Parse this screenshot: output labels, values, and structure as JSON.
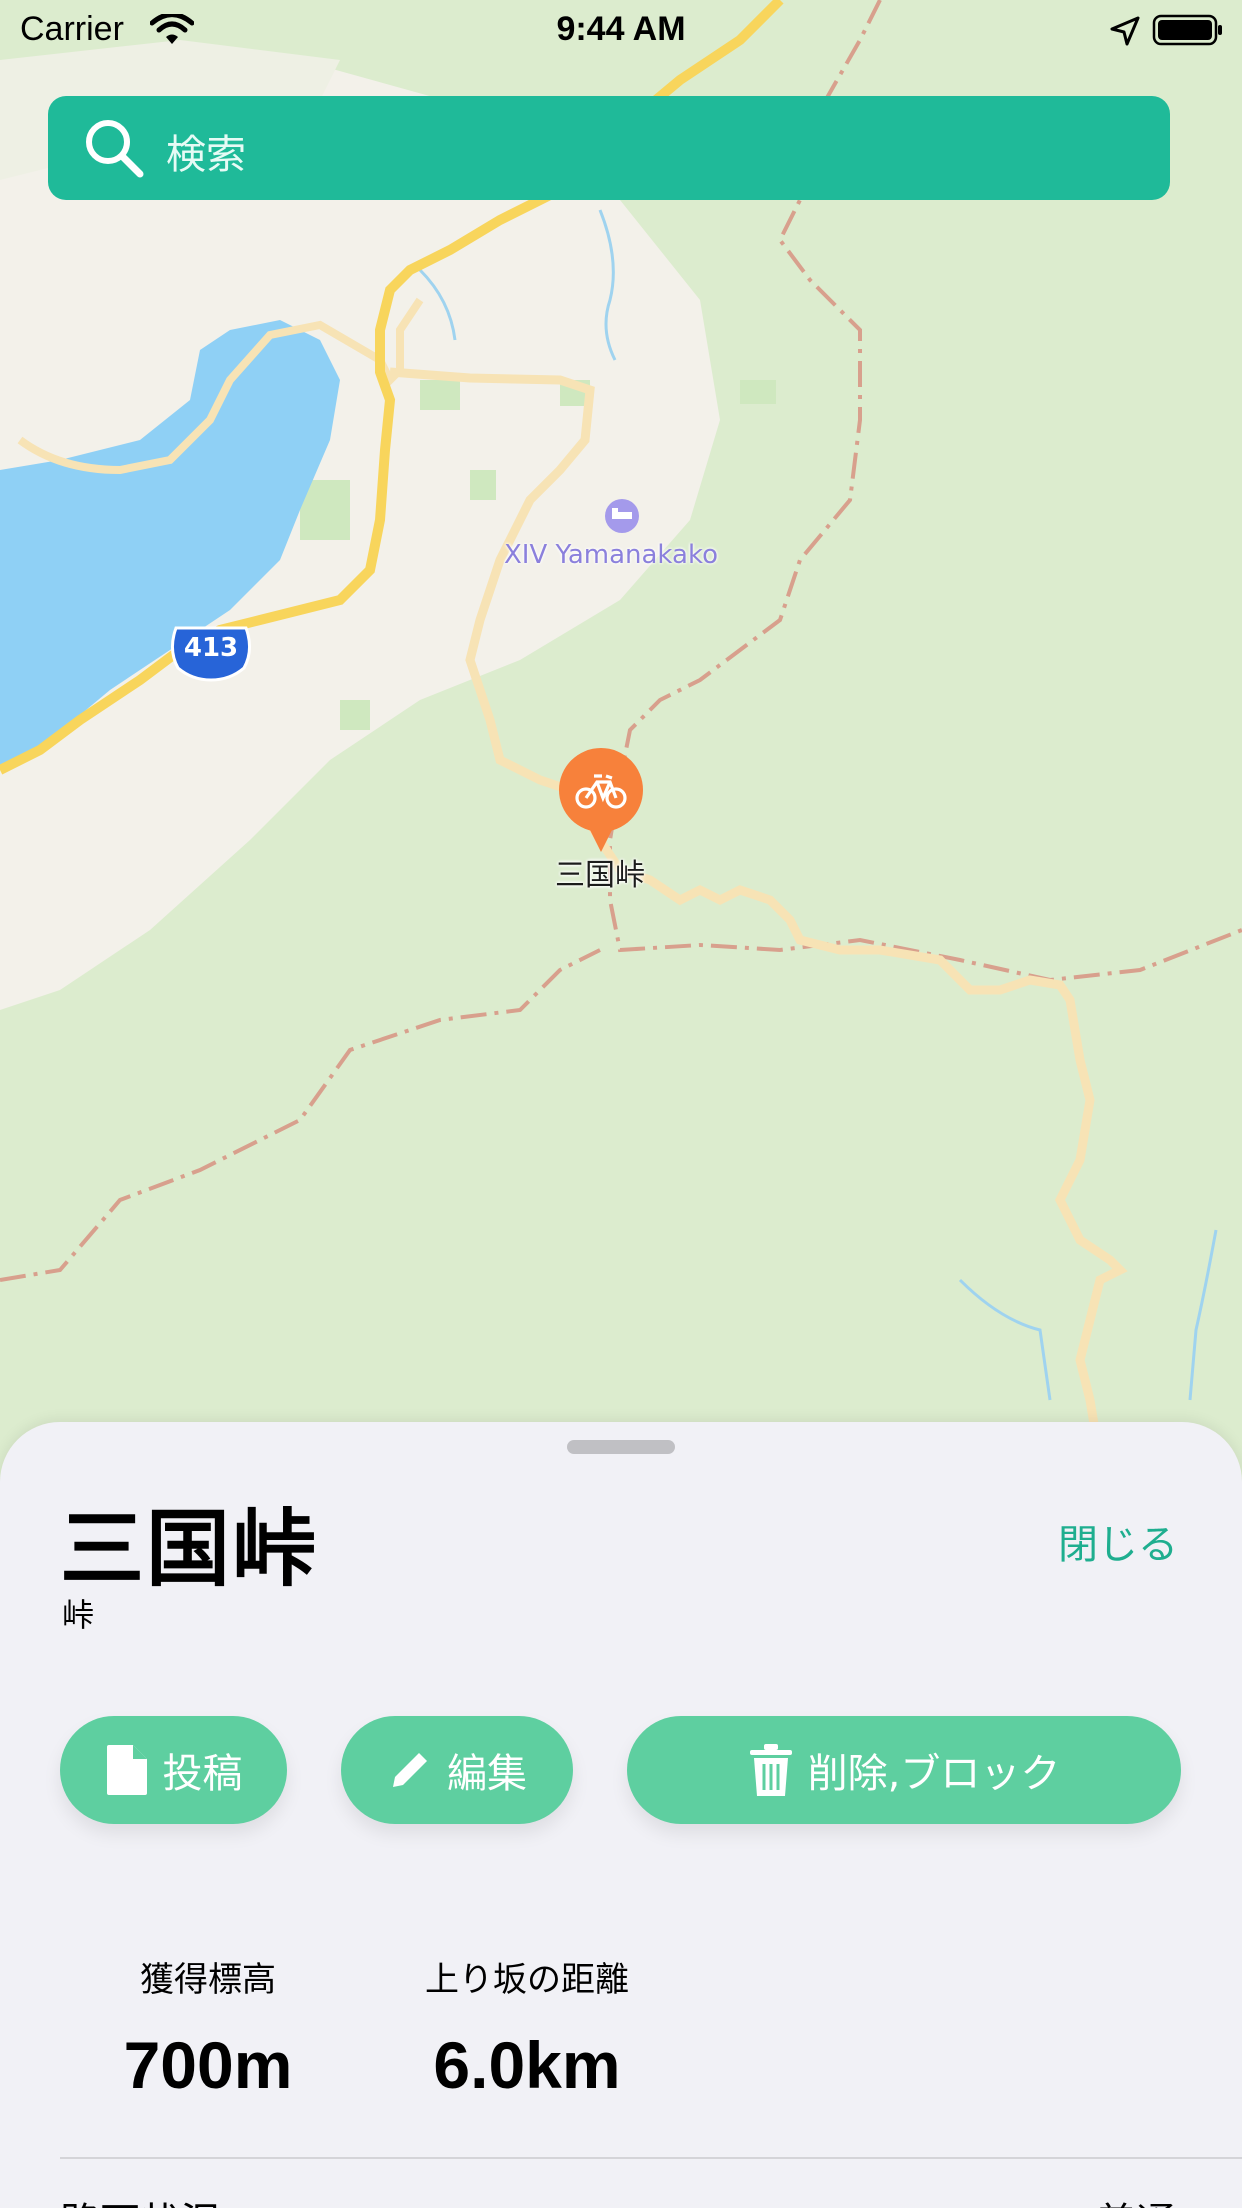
{
  "status_bar": {
    "carrier": "Carrier",
    "time": "9:44 AM"
  },
  "search": {
    "placeholder": "検索",
    "icon": "search-icon"
  },
  "map": {
    "poi_label": "XIV Yamanakako",
    "route_shield": "413",
    "pin_label": "三国峠",
    "pin_icon": "bicycle-icon",
    "colors": {
      "forest": "#dcecce",
      "lake": "#8fd0f5",
      "road_major": "#f8d55c",
      "road_minor": "#f7e3b5",
      "pin": "#f7813b",
      "boundary": "#d8a08d"
    }
  },
  "sheet": {
    "title": "三国峠",
    "subtitle": "峠",
    "close_label": "閉じる",
    "buttons": {
      "post": "投稿",
      "edit": "編集",
      "delete": "削除,ブロック"
    },
    "stats": [
      {
        "label": "獲得標高",
        "value": "700m"
      },
      {
        "label": "上り坂の距離",
        "value": "6.0km"
      }
    ],
    "road_condition": {
      "label": "路面状況",
      "value": "普通"
    },
    "accent_color": "#1fba99",
    "button_color": "#5ecfa0"
  }
}
